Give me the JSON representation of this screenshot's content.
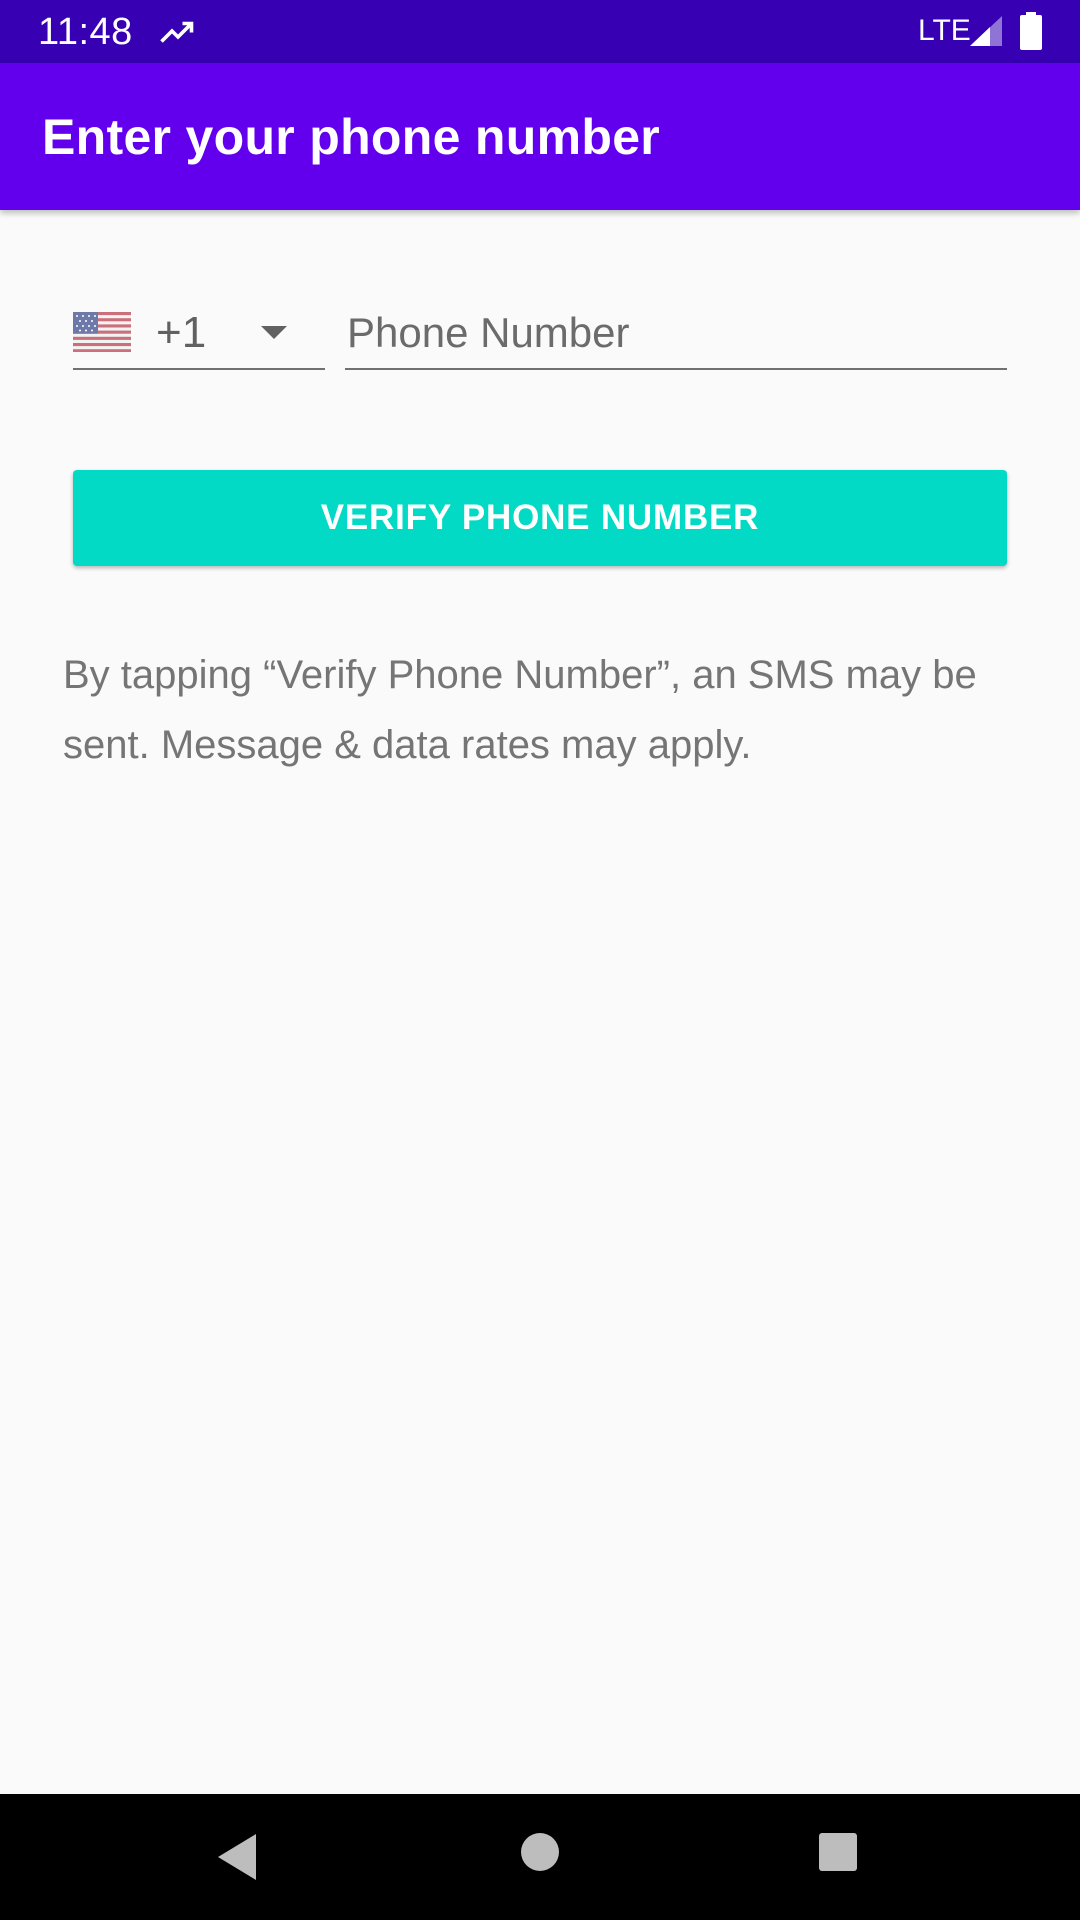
{
  "status_bar": {
    "time": "11:48",
    "network": "LTE",
    "icons": [
      "trending-up-icon",
      "signal-icon",
      "battery-icon"
    ]
  },
  "app_bar": {
    "title": "Enter your phone number",
    "color": "#6200ee"
  },
  "phone_form": {
    "country": {
      "flag_icon": "us-flag-icon",
      "code": "+1"
    },
    "phone_field": {
      "value": "",
      "placeholder": "Phone Number"
    },
    "verify_button_label": "VERIFY PHONE NUMBER",
    "verify_button_color": "#03dac5",
    "disclaimer": "By tapping “Verify Phone Number”, an SMS may be sent. Message & data rates may apply."
  },
  "nav_bar": {
    "icons": [
      "back-icon",
      "home-icon",
      "recents-icon"
    ]
  }
}
